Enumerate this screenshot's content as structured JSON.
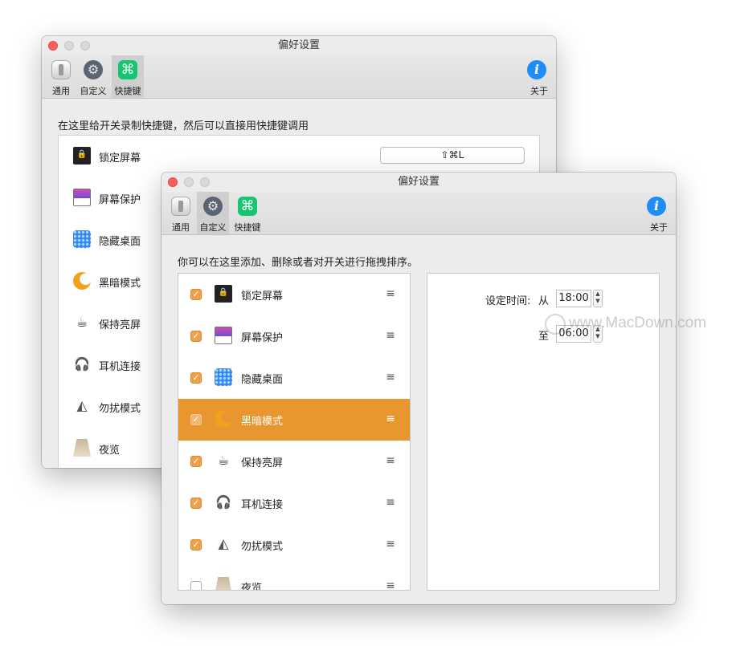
{
  "back_window": {
    "title": "偏好设置",
    "toolbar": [
      {
        "label": "通用",
        "icon": "general-switch-icon"
      },
      {
        "label": "自定义",
        "icon": "customize-icon"
      },
      {
        "label": "快捷键",
        "icon": "shortcut-command-icon",
        "glyph": "⌘"
      }
    ],
    "about_label": "关于",
    "about_glyph": "i",
    "hint": "在这里给开关录制快捷键，然后可以直接用快捷键调用",
    "shortcut_value": "⇧⌘L",
    "items": [
      {
        "label": "锁定屏幕",
        "icon": "lock-screen-icon"
      },
      {
        "label": "屏幕保护",
        "icon": "screensaver-icon"
      },
      {
        "label": "隐藏桌面",
        "icon": "hide-desktop-icon"
      },
      {
        "label": "黑暗模式",
        "icon": "dark-mode-icon"
      },
      {
        "label": "保持亮屏",
        "icon": "keep-awake-icon"
      },
      {
        "label": "耳机连接",
        "icon": "headphones-icon"
      },
      {
        "label": "勿扰模式",
        "icon": "do-not-disturb-icon"
      },
      {
        "label": "夜览",
        "icon": "night-shift-icon"
      }
    ]
  },
  "front_window": {
    "title": "偏好设置",
    "toolbar": [
      {
        "label": "通用",
        "icon": "general-switch-icon"
      },
      {
        "label": "自定义",
        "icon": "customize-icon"
      },
      {
        "label": "快捷键",
        "icon": "shortcut-command-icon",
        "glyph": "⌘"
      }
    ],
    "selected_tab": "自定义",
    "about_label": "关于",
    "about_glyph": "i",
    "hint": "你可以在这里添加、删除或者对开关进行拖拽排序。",
    "items": [
      {
        "label": "锁定屏幕",
        "checked": true,
        "icon": "lock-screen-icon"
      },
      {
        "label": "屏幕保护",
        "checked": true,
        "icon": "screensaver-icon"
      },
      {
        "label": "隐藏桌面",
        "checked": true,
        "icon": "hide-desktop-icon"
      },
      {
        "label": "黑暗模式",
        "checked": true,
        "selected": true,
        "icon": "dark-mode-icon"
      },
      {
        "label": "保持亮屏",
        "checked": true,
        "icon": "keep-awake-icon"
      },
      {
        "label": "耳机连接",
        "checked": true,
        "icon": "headphones-icon"
      },
      {
        "label": "勿扰模式",
        "checked": true,
        "icon": "do-not-disturb-icon"
      },
      {
        "label": "夜览",
        "checked": false,
        "icon": "night-shift-icon"
      }
    ],
    "schedule": {
      "label": "设定时间:",
      "from_label": "从",
      "from_time": "18:00",
      "to_label": "至",
      "to_time": "06:00"
    }
  },
  "watermark": "www.MacDown.com",
  "colors": {
    "accent": "#e8962f",
    "checkbox": "#f0a04b",
    "shortcut_icon": "#17c470",
    "about_icon": "#1e8df5"
  }
}
